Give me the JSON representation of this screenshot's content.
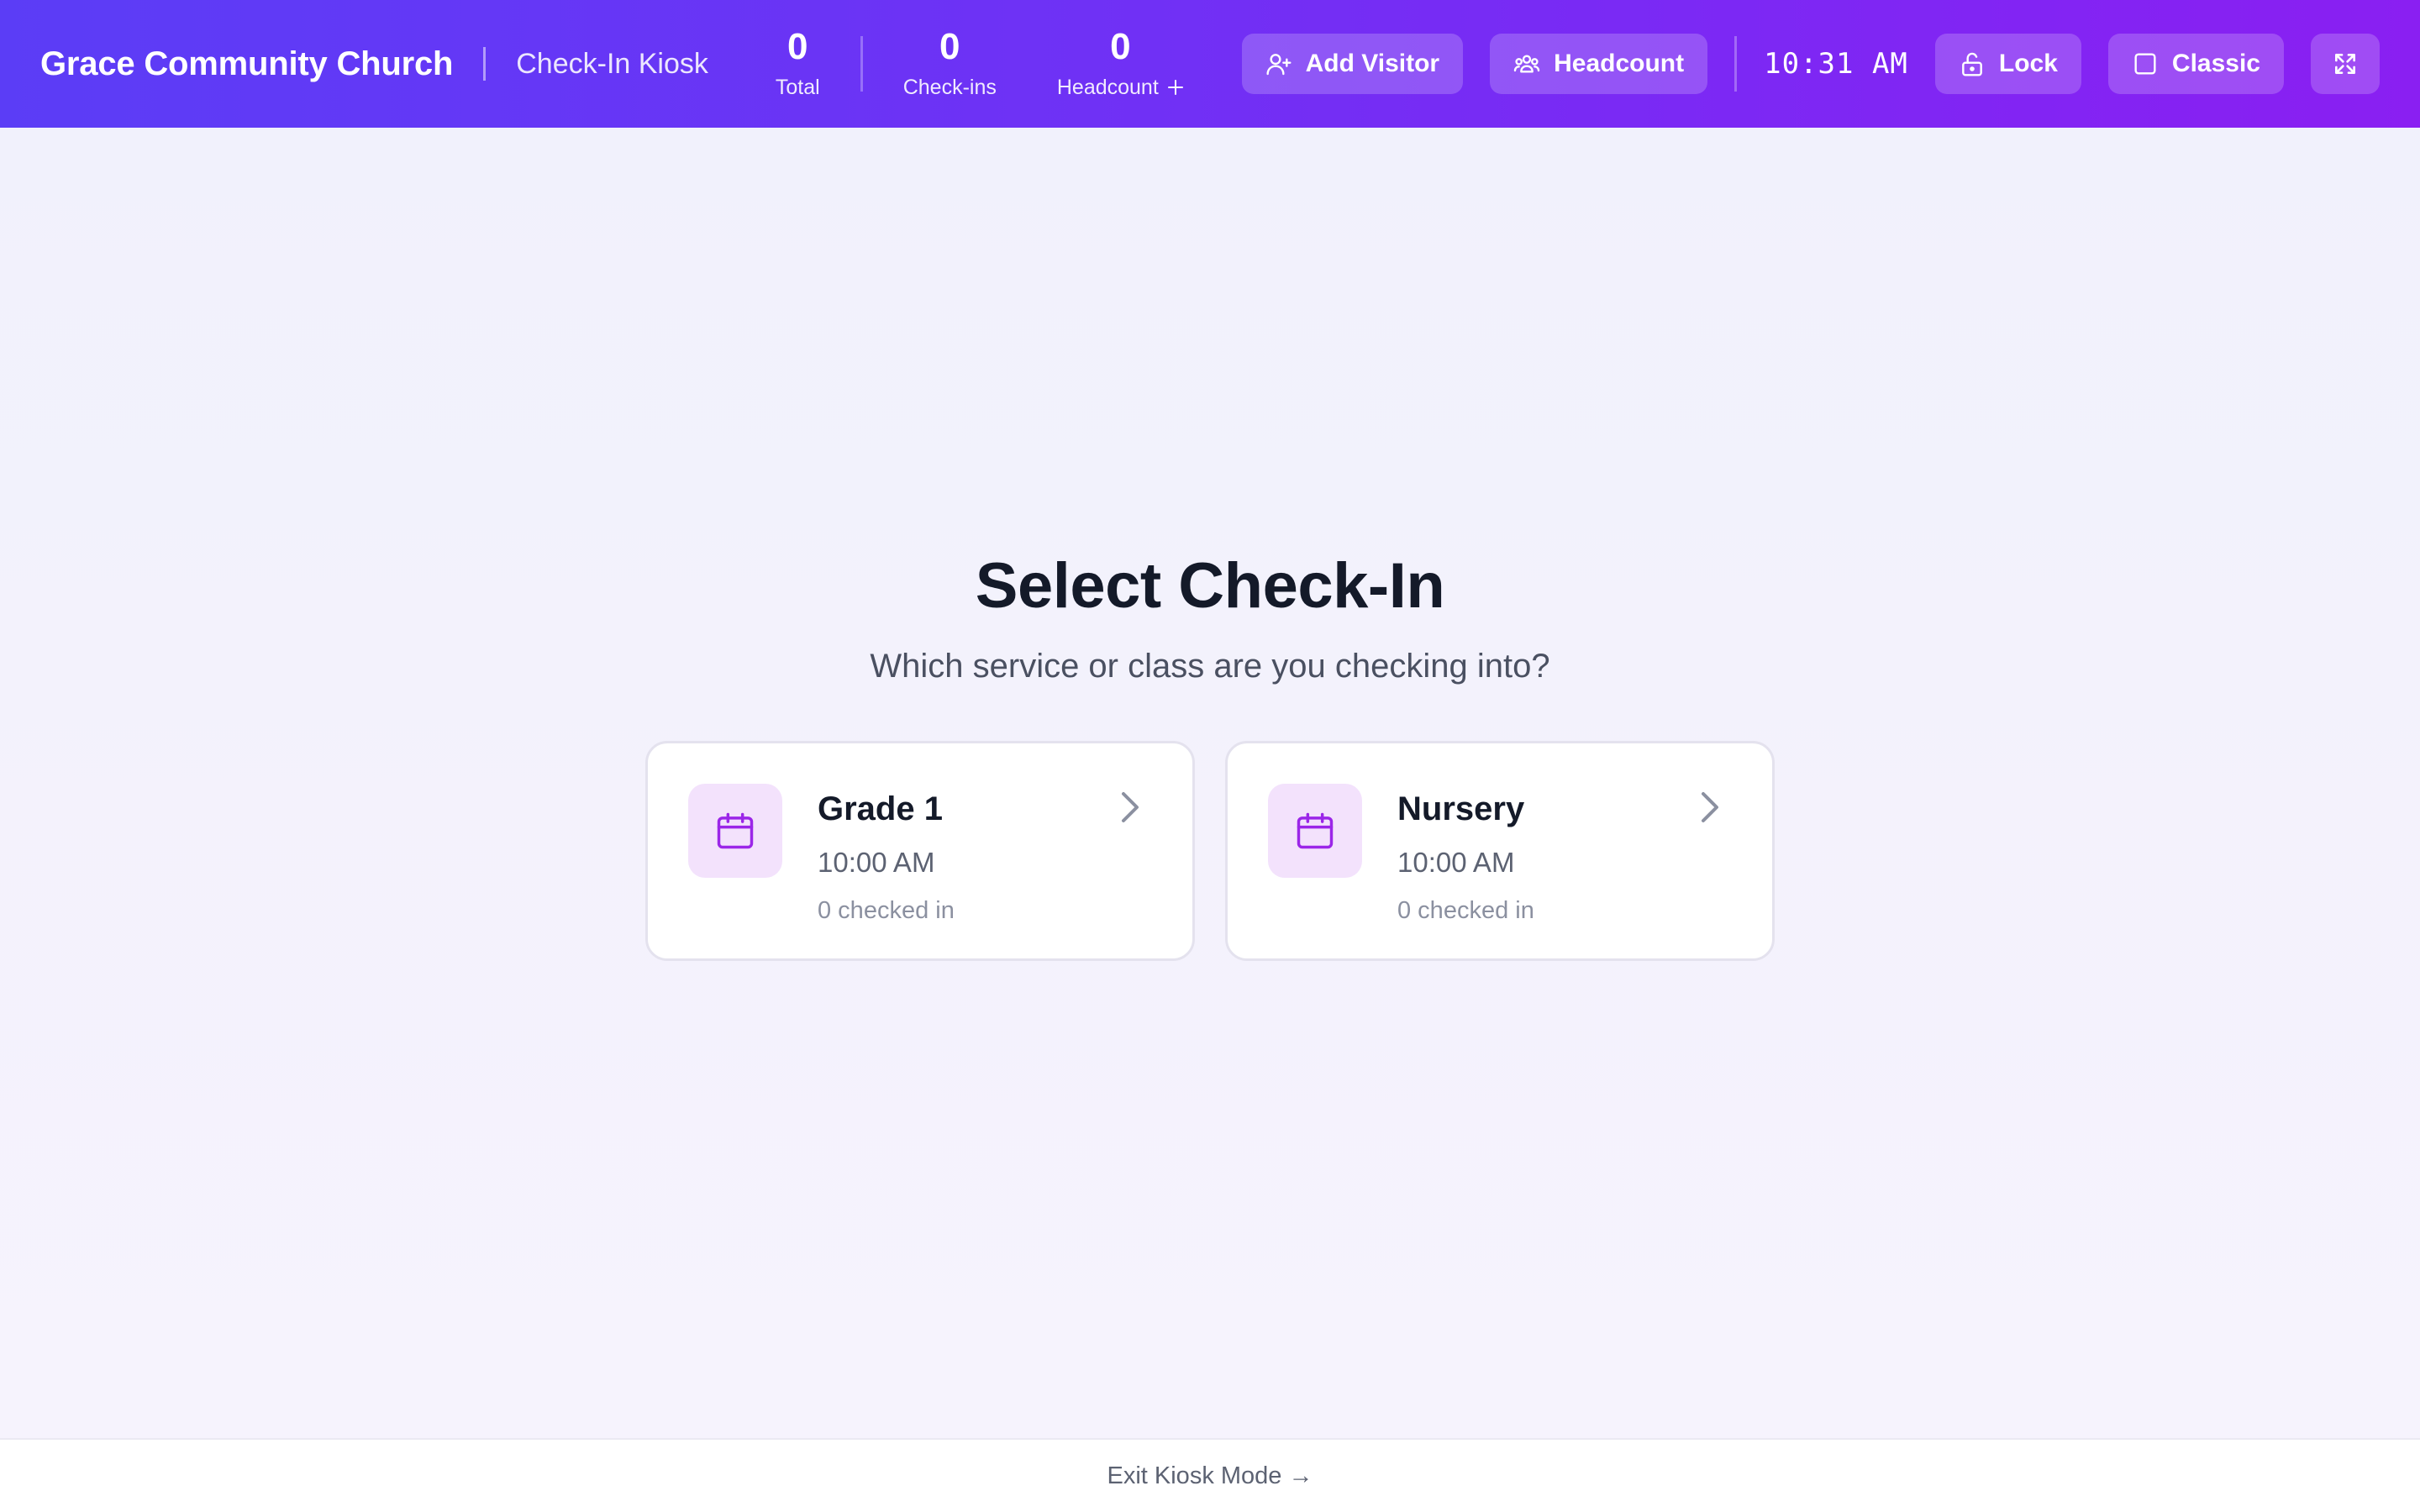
{
  "header": {
    "brand": "Grace Community Church",
    "subtitle": "Check-In Kiosk",
    "stats": [
      {
        "value": "0",
        "label": "Total"
      },
      {
        "value": "0",
        "label": "Check-ins"
      },
      {
        "value": "0",
        "label": "Headcount"
      }
    ],
    "buttons": {
      "add_visitor": "Add Visitor",
      "headcount": "Headcount",
      "lock": "Lock",
      "classic": "Classic"
    },
    "clock": "10:31 AM"
  },
  "main": {
    "title": "Select Check-In",
    "subtitle": "Which service or class are you checking into?",
    "cards": [
      {
        "title": "Grade 1",
        "time": "10:00 AM",
        "count": "0 checked in"
      },
      {
        "title": "Nursery",
        "time": "10:00 AM",
        "count": "0 checked in"
      }
    ]
  },
  "footer": {
    "exit_label": "Exit Kiosk Mode →"
  },
  "colors": {
    "header_gradient_start": "#5b3df6",
    "header_gradient_end": "#8a1ff2",
    "accent": "#9b26e8",
    "icon_tile": "#f3e2fc"
  }
}
